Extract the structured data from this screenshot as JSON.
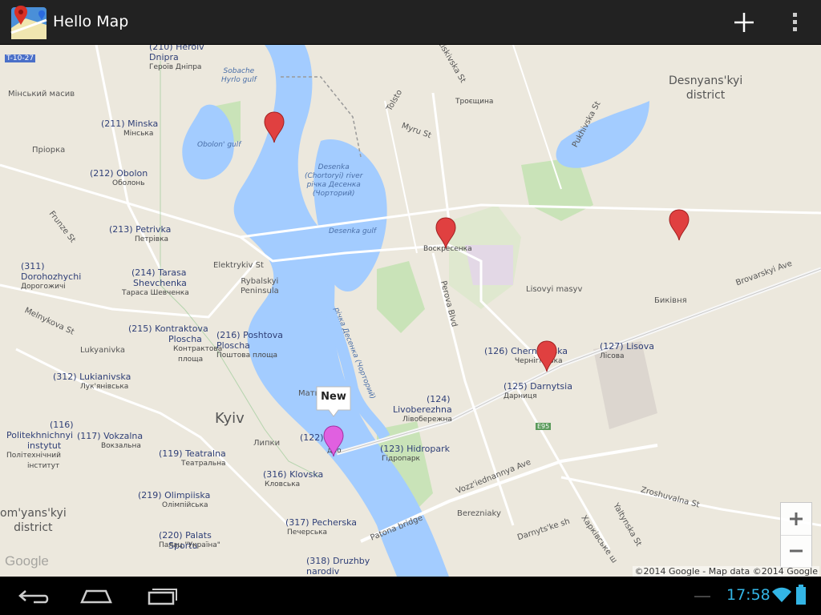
{
  "app": {
    "title": "Hello Map"
  },
  "actions": {
    "add_icon": "plus-icon",
    "overflow_icon": "overflow-menu-icon"
  },
  "map": {
    "labels": {
      "t1027": "T-10-27",
      "minsky_masiv": "Мінський масив",
      "priorka": "Пріорка",
      "desnyanskyi": "Desnyans'kyi",
      "desnyanskyi2": "district",
      "kyiv": "Kyiv",
      "solomyanskyi": "om'yans'kyi",
      "solomyanskyi2": "district",
      "lukyanivka": "Lukyanivka",
      "lypky": "Липки",
      "matv": "Матв",
      "lisovyi": "Lisovyi masyv",
      "bykivnia": "Биківня",
      "voskresenka": "Воскресенка",
      "troieshchyna": "Троєщина",
      "berezniaky": "Berezniaky",
      "obolon_gulf": "Obolon' gulf",
      "sobache": "Sobache",
      "sobache2": "Hyrlo gulf",
      "desenka1": "Desenka",
      "desenka2": "(Chortoryi) river",
      "desenka3": "річка Десенка",
      "desenka4": "(Чорторий)",
      "desenka_gulf": "Desenka gulf",
      "desenka_river_ua": "річка Десенка (Чорторий)",
      "rybalskyi": "Rybalskyi",
      "rybalskyi2": "Peninsula",
      "frunze": "Frunze St",
      "melnykova": "Melnykova St",
      "elektrykiv": "Elektrykiv St",
      "perova": "Perova Blvd",
      "brovarskyi": "Brovarskyi Ave",
      "pukhivska": "Pukhivska St",
      "liskivska": "Liskivska St",
      "myru": "Myru St",
      "tolsto": "Tolsto",
      "vozz": "Vozz'iednannya Ave",
      "patona": "Patona bridge",
      "darnytske": "Darnyts'ke sh",
      "kharkivske": "Харківське ш",
      "yaltynska": "Yaltynska St",
      "zroshuvalna": "Zroshuvalna St",
      "e95": "E95",
      "dno": "дно"
    },
    "stations": [
      {
        "en": "(210) Heroiv",
        "en2": "Dnipra",
        "ua": "Героїв Дніпра"
      },
      {
        "en": "(211) Minska",
        "ua": "Мінська"
      },
      {
        "en": "(212) Obolon",
        "ua": "Оболонь"
      },
      {
        "en": "(213) Petrivka",
        "ua": "Петрівка"
      },
      {
        "en": "(214) Tarasa",
        "en2": "Shevchenka",
        "ua": "Тараса Шевченка"
      },
      {
        "en": "(311)",
        "en2": "Dorohozhychi",
        "ua": "Дорогожичі"
      },
      {
        "en": "(215) Kontraktova",
        "en2": "Ploscha",
        "ua": "Контрактова",
        "ua2": "площа"
      },
      {
        "en": "(216) Poshtova",
        "en2": "Ploscha",
        "ua": "Поштова площа"
      },
      {
        "en": "(312) Lukianivska",
        "ua": "Лук'янівська"
      },
      {
        "en": "(116)",
        "en2": "Politekhnichnyi",
        "en3": "instytut",
        "ua": "Політехнічний",
        "ua2": "інститут"
      },
      {
        "en": "(117) Vokzalna",
        "ua": "Вокзальна"
      },
      {
        "en": "(119) Teatralna",
        "ua": "Театральна"
      },
      {
        "en": "(219) Olimpiiska",
        "ua": "Олімпійська"
      },
      {
        "en": "(220) Palats",
        "en2": "Sportu",
        "ua": "Палац \"Україна\""
      },
      {
        "en": "(316) Klovska",
        "ua": "Кловська"
      },
      {
        "en": "(317) Pecherska",
        "ua": "Печерська"
      },
      {
        "en": "(318) Druzhby",
        "en2": "narodiv"
      },
      {
        "en": "(122) D",
        "ua": "Дніпро"
      },
      {
        "en": "(123) Hidropark",
        "ua": "Гідропарк"
      },
      {
        "en": "(124)",
        "en2": "Livoberezhna",
        "ua": "Лівобережна"
      },
      {
        "en": "(125) Darnytsia",
        "ua": "Дарниця"
      },
      {
        "en": "(126) Chernihivska",
        "ua": "Чернігівська"
      },
      {
        "en": "(127) Lisova",
        "ua": "Лісова"
      }
    ],
    "markers": [
      {
        "id": "marker-1",
        "color": "#e04040"
      },
      {
        "id": "marker-2",
        "color": "#e04040"
      },
      {
        "id": "marker-3",
        "color": "#e04040"
      },
      {
        "id": "marker-4",
        "color": "#e04040"
      },
      {
        "id": "marker-new",
        "color": "#e060e0"
      }
    ],
    "infowindow": {
      "text": "New"
    },
    "zoom": {
      "in_label": "+",
      "out_label": "−"
    },
    "attribution": "©2014 Google - Map data ©2014 Google",
    "logo": "Google"
  },
  "status": {
    "time": "17:58"
  },
  "colors": {
    "water": "#a3ccff",
    "land": "#ece8dd",
    "park": "#c9e3b8",
    "actionbar": "#222222",
    "clock": "#33b5e5"
  }
}
